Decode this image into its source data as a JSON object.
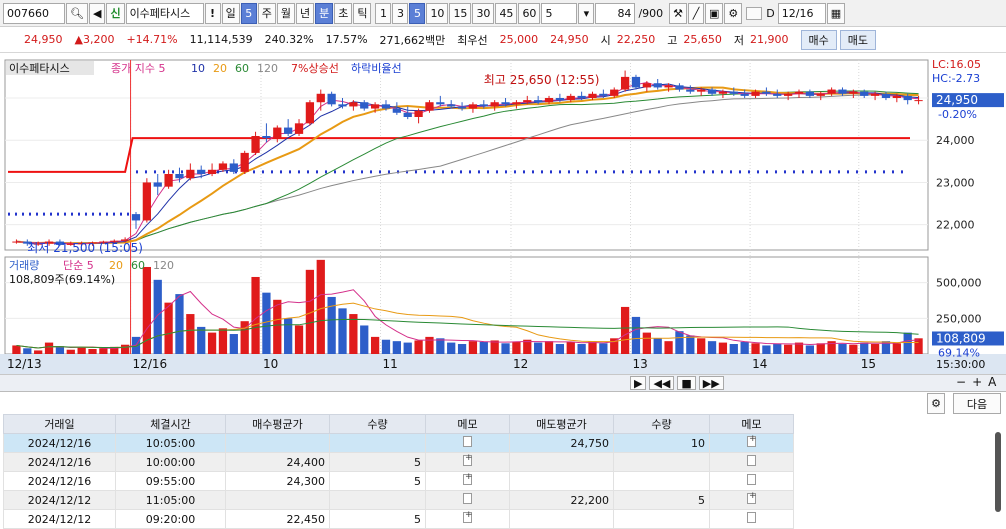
{
  "toolbar": {
    "code": "007660",
    "name_tag": "신",
    "stock_name": "이수페타시스",
    "warn": "!",
    "periods": [
      "일",
      "5",
      "주",
      "월",
      "년",
      "분",
      "초",
      "틱"
    ],
    "active_periods": [
      "5",
      "분"
    ],
    "minutes": [
      "1",
      "3",
      "5",
      "10",
      "15",
      "30",
      "45",
      "60"
    ],
    "active_minute": "5",
    "count_value": "5",
    "range_value": "84",
    "range_total": "/900",
    "checkbox_label": "D",
    "date": "12/16"
  },
  "quote": {
    "price": "24,950",
    "change": "3,200",
    "change_pct": "+14.71%",
    "volume": "11,114,539",
    "volume_ratio": "240.32%",
    "turnover": "17.57%",
    "amount": "271,662백만",
    "priority_label": "최우선",
    "ask": "25,000",
    "bid": "24,950",
    "open_label": "시",
    "open": "22,250",
    "high_label": "고",
    "high": "25,650",
    "low_label": "저",
    "low": "21,900",
    "buy_label": "매수",
    "sell_label": "매도"
  },
  "chart_labels": {
    "stock": "이수페타시스",
    "ma_label": "종가 지수 5",
    "ma10": "10",
    "ma20": "20",
    "ma60": "60",
    "ma120": "120",
    "up_line": "7%상승선",
    "down_line": "하락비율선",
    "high_note": "최고 25,650 (12:55)",
    "low_note": "최저 21,500 (15:05)",
    "lc": "LC:16.05",
    "hc": "HC:-2.73",
    "last_price": "24,950",
    "last_pct": "-0.20%",
    "vol_title": "거래량",
    "vol_ma_label": "단순 5",
    "vol_ma20": "20",
    "vol_ma60": "60",
    "vol_ma120": "120",
    "vol_value": "108,809주(69.14%)",
    "vol_last": "108,809",
    "vol_last_pct": "69.14%",
    "time_label": "15:30:00",
    "next_label": "다음"
  },
  "colors": {
    "up": "#e01b1b",
    "down": "#2d5ec9",
    "ma5": "#d4308a",
    "ma10": "#1f32a8",
    "ma20": "#e89a14",
    "ma60": "#2a8a35",
    "ma120": "#888888",
    "bg": "#ffffff"
  },
  "chart_data": {
    "type": "candlestick",
    "price_axis": {
      "ticks": [
        "25,000",
        "24,000",
        "23,000",
        "22,000"
      ],
      "ylim": [
        21400,
        25900
      ]
    },
    "volume_axis": {
      "ticks": [
        "500,000",
        "250,000"
      ],
      "ylim": [
        0,
        680000
      ]
    },
    "x_labels": [
      "12/13",
      "12/16",
      "10",
      "11",
      "12",
      "13",
      "14",
      "15"
    ],
    "candles": [
      {
        "o": 21600,
        "h": 21650,
        "l": 21550,
        "c": 21600,
        "v": 60000
      },
      {
        "o": 21600,
        "h": 21650,
        "l": 21500,
        "c": 21550,
        "v": 40000
      },
      {
        "o": 21550,
        "h": 21600,
        "l": 21500,
        "c": 21550,
        "v": 25000
      },
      {
        "o": 21550,
        "h": 21650,
        "l": 21500,
        "c": 21600,
        "v": 80000
      },
      {
        "o": 21600,
        "h": 21650,
        "l": 21500,
        "c": 21520,
        "v": 55000
      },
      {
        "o": 21520,
        "h": 21600,
        "l": 21500,
        "c": 21550,
        "v": 30000
      },
      {
        "o": 21550,
        "h": 21600,
        "l": 21500,
        "c": 21560,
        "v": 45000
      },
      {
        "o": 21560,
        "h": 21600,
        "l": 21500,
        "c": 21580,
        "v": 35000
      },
      {
        "o": 21580,
        "h": 21620,
        "l": 21550,
        "c": 21600,
        "v": 40000
      },
      {
        "o": 21600,
        "h": 21650,
        "l": 21550,
        "c": 21620,
        "v": 50000
      },
      {
        "o": 21620,
        "h": 21700,
        "l": 21580,
        "c": 21650,
        "v": 65000
      },
      {
        "o": 22250,
        "h": 22300,
        "l": 21900,
        "c": 22100,
        "v": 120000
      },
      {
        "o": 22100,
        "h": 23100,
        "l": 22050,
        "c": 23000,
        "v": 610000
      },
      {
        "o": 23000,
        "h": 23200,
        "l": 22700,
        "c": 22900,
        "v": 520000
      },
      {
        "o": 22900,
        "h": 23300,
        "l": 22850,
        "c": 23200,
        "v": 360000
      },
      {
        "o": 23200,
        "h": 23350,
        "l": 23000,
        "c": 23100,
        "v": 420000
      },
      {
        "o": 23100,
        "h": 23450,
        "l": 23050,
        "c": 23300,
        "v": 280000
      },
      {
        "o": 23300,
        "h": 23400,
        "l": 23100,
        "c": 23200,
        "v": 190000
      },
      {
        "o": 23200,
        "h": 23450,
        "l": 23150,
        "c": 23300,
        "v": 150000
      },
      {
        "o": 23300,
        "h": 23500,
        "l": 23250,
        "c": 23450,
        "v": 180000
      },
      {
        "o": 23450,
        "h": 23550,
        "l": 23200,
        "c": 23250,
        "v": 140000
      },
      {
        "o": 23250,
        "h": 23750,
        "l": 23200,
        "c": 23700,
        "v": 230000
      },
      {
        "o": 23700,
        "h": 24200,
        "l": 23650,
        "c": 24100,
        "v": 540000
      },
      {
        "o": 24100,
        "h": 24400,
        "l": 23950,
        "c": 24050,
        "v": 430000
      },
      {
        "o": 24050,
        "h": 24350,
        "l": 23950,
        "c": 24300,
        "v": 380000
      },
      {
        "o": 24300,
        "h": 24500,
        "l": 24100,
        "c": 24150,
        "v": 250000
      },
      {
        "o": 24150,
        "h": 24500,
        "l": 24100,
        "c": 24400,
        "v": 200000
      },
      {
        "o": 24400,
        "h": 24950,
        "l": 24350,
        "c": 24900,
        "v": 590000
      },
      {
        "o": 24900,
        "h": 25200,
        "l": 24700,
        "c": 25100,
        "v": 660000
      },
      {
        "o": 25100,
        "h": 25150,
        "l": 24800,
        "c": 24850,
        "v": 400000
      },
      {
        "o": 24850,
        "h": 25000,
        "l": 24750,
        "c": 24800,
        "v": 320000
      },
      {
        "o": 24800,
        "h": 24950,
        "l": 24700,
        "c": 24900,
        "v": 280000
      },
      {
        "o": 24900,
        "h": 24950,
        "l": 24700,
        "c": 24750,
        "v": 200000
      },
      {
        "o": 24750,
        "h": 24900,
        "l": 24650,
        "c": 24850,
        "v": 120000
      },
      {
        "o": 24850,
        "h": 24950,
        "l": 24700,
        "c": 24750,
        "v": 100000
      },
      {
        "o": 24750,
        "h": 24900,
        "l": 24600,
        "c": 24650,
        "v": 90000
      },
      {
        "o": 24650,
        "h": 24800,
        "l": 24500,
        "c": 24550,
        "v": 80000
      },
      {
        "o": 24550,
        "h": 24750,
        "l": 24400,
        "c": 24700,
        "v": 95000
      },
      {
        "o": 24700,
        "h": 24950,
        "l": 24650,
        "c": 24900,
        "v": 120000
      },
      {
        "o": 24900,
        "h": 25050,
        "l": 24800,
        "c": 24850,
        "v": 110000
      },
      {
        "o": 24850,
        "h": 24950,
        "l": 24750,
        "c": 24800,
        "v": 80000
      },
      {
        "o": 24800,
        "h": 24900,
        "l": 24700,
        "c": 24750,
        "v": 70000
      },
      {
        "o": 24750,
        "h": 24900,
        "l": 24650,
        "c": 24850,
        "v": 90000
      },
      {
        "o": 24850,
        "h": 24950,
        "l": 24750,
        "c": 24800,
        "v": 85000
      },
      {
        "o": 24800,
        "h": 24950,
        "l": 24700,
        "c": 24900,
        "v": 95000
      },
      {
        "o": 24900,
        "h": 25000,
        "l": 24800,
        "c": 24850,
        "v": 75000
      },
      {
        "o": 24850,
        "h": 24950,
        "l": 24750,
        "c": 24900,
        "v": 85000
      },
      {
        "o": 24900,
        "h": 25050,
        "l": 24850,
        "c": 24950,
        "v": 100000
      },
      {
        "o": 24950,
        "h": 25050,
        "l": 24850,
        "c": 24900,
        "v": 80000
      },
      {
        "o": 24900,
        "h": 25050,
        "l": 24850,
        "c": 25000,
        "v": 90000
      },
      {
        "o": 25000,
        "h": 25100,
        "l": 24900,
        "c": 24950,
        "v": 70000
      },
      {
        "o": 24950,
        "h": 25100,
        "l": 24900,
        "c": 25050,
        "v": 85000
      },
      {
        "o": 25050,
        "h": 25150,
        "l": 24950,
        "c": 25000,
        "v": 70000
      },
      {
        "o": 25000,
        "h": 25150,
        "l": 24950,
        "c": 25100,
        "v": 90000
      },
      {
        "o": 25100,
        "h": 25200,
        "l": 25000,
        "c": 25050,
        "v": 75000
      },
      {
        "o": 25050,
        "h": 25250,
        "l": 25000,
        "c": 25200,
        "v": 110000
      },
      {
        "o": 25200,
        "h": 25650,
        "l": 25150,
        "c": 25500,
        "v": 330000
      },
      {
        "o": 25500,
        "h": 25550,
        "l": 25200,
        "c": 25250,
        "v": 260000
      },
      {
        "o": 25250,
        "h": 25400,
        "l": 25150,
        "c": 25350,
        "v": 150000
      },
      {
        "o": 25350,
        "h": 25450,
        "l": 25200,
        "c": 25250,
        "v": 110000
      },
      {
        "o": 25250,
        "h": 25350,
        "l": 25150,
        "c": 25300,
        "v": 90000
      },
      {
        "o": 25300,
        "h": 25350,
        "l": 25150,
        "c": 25200,
        "v": 160000
      },
      {
        "o": 25200,
        "h": 25300,
        "l": 25100,
        "c": 25150,
        "v": 130000
      },
      {
        "o": 25150,
        "h": 25250,
        "l": 25050,
        "c": 25200,
        "v": 110000
      },
      {
        "o": 25200,
        "h": 25250,
        "l": 25050,
        "c": 25100,
        "v": 90000
      },
      {
        "o": 25100,
        "h": 25200,
        "l": 25000,
        "c": 25150,
        "v": 80000
      },
      {
        "o": 25150,
        "h": 25250,
        "l": 25050,
        "c": 25100,
        "v": 70000
      },
      {
        "o": 25100,
        "h": 25200,
        "l": 25000,
        "c": 25050,
        "v": 85000
      },
      {
        "o": 25050,
        "h": 25200,
        "l": 25000,
        "c": 25150,
        "v": 75000
      },
      {
        "o": 25150,
        "h": 25250,
        "l": 25050,
        "c": 25100,
        "v": 60000
      },
      {
        "o": 25100,
        "h": 25200,
        "l": 25000,
        "c": 25050,
        "v": 70000
      },
      {
        "o": 25050,
        "h": 25150,
        "l": 24950,
        "c": 25100,
        "v": 65000
      },
      {
        "o": 25100,
        "h": 25200,
        "l": 25000,
        "c": 25150,
        "v": 80000
      },
      {
        "o": 25150,
        "h": 25200,
        "l": 25000,
        "c": 25050,
        "v": 60000
      },
      {
        "o": 25050,
        "h": 25150,
        "l": 24950,
        "c": 25100,
        "v": 75000
      },
      {
        "o": 25100,
        "h": 25250,
        "l": 25050,
        "c": 25200,
        "v": 90000
      },
      {
        "o": 25200,
        "h": 25250,
        "l": 25050,
        "c": 25100,
        "v": 70000
      },
      {
        "o": 25100,
        "h": 25200,
        "l": 25000,
        "c": 25150,
        "v": 65000
      },
      {
        "o": 25150,
        "h": 25200,
        "l": 25000,
        "c": 25050,
        "v": 80000
      },
      {
        "o": 25050,
        "h": 25150,
        "l": 24950,
        "c": 25100,
        "v": 70000
      },
      {
        "o": 25100,
        "h": 25150,
        "l": 24950,
        "c": 25000,
        "v": 90000
      },
      {
        "o": 25000,
        "h": 25100,
        "l": 24900,
        "c": 25050,
        "v": 75000
      },
      {
        "o": 25050,
        "h": 25100,
        "l": 24850,
        "c": 24950,
        "v": 150000
      },
      {
        "o": 24950,
        "h": 25050,
        "l": 24850,
        "c": 24950,
        "v": 110000
      }
    ]
  },
  "table": {
    "headers": [
      "거래일",
      "체결시간",
      "매수평균가",
      "수량",
      "메모",
      "매도평균가",
      "수량",
      "메모"
    ],
    "rows": [
      [
        "2024/12/16",
        "10:05:00",
        "",
        "",
        "",
        "24,750",
        "10",
        "+"
      ],
      [
        "2024/12/16",
        "10:00:00",
        "24,400",
        "5",
        "+",
        "",
        "",
        ""
      ],
      [
        "2024/12/16",
        "09:55:00",
        "24,300",
        "5",
        "+",
        "",
        "",
        ""
      ],
      [
        "2024/12/12",
        "11:05:00",
        "",
        "",
        "",
        "22,200",
        "5",
        "+"
      ],
      [
        "2024/12/12",
        "09:20:00",
        "22,450",
        "5",
        "+",
        "",
        "",
        ""
      ]
    ]
  }
}
